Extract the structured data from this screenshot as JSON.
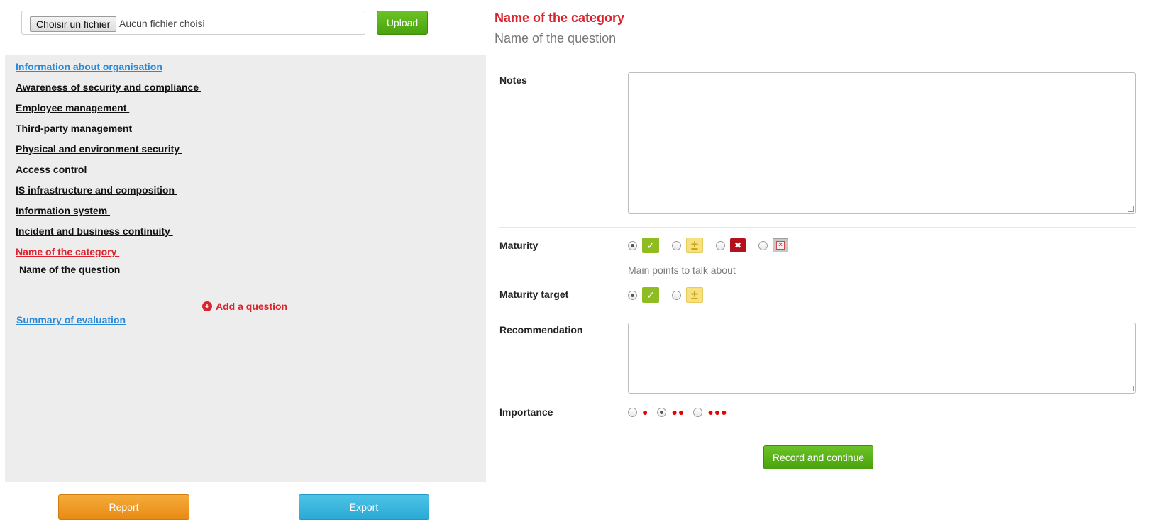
{
  "upload": {
    "choose_label": "Choisir un fichier",
    "file_status": "Aucun fichier choisi",
    "upload_label": "Upload"
  },
  "nav": {
    "items": [
      {
        "label": "Information about organisation",
        "style": "blue"
      },
      {
        "label": "Awareness of security and compliance ",
        "style": "normal"
      },
      {
        "label": "Employee management ",
        "style": "normal"
      },
      {
        "label": "Third-party management ",
        "style": "normal"
      },
      {
        "label": "Physical and environment security ",
        "style": "normal"
      },
      {
        "label": "Access control ",
        "style": "normal"
      },
      {
        "label": "IS infrastructure and composition ",
        "style": "normal"
      },
      {
        "label": "Information system ",
        "style": "normal"
      },
      {
        "label": "Incident and business continuity ",
        "style": "normal"
      },
      {
        "label": "Name of the category ",
        "style": "red"
      }
    ],
    "active_question": "Name of the question",
    "add_question": "Add a question",
    "summary": "Summary of evaluation"
  },
  "actions": {
    "report": "Report",
    "export": "Export",
    "record": "Record and continue"
  },
  "header": {
    "category": "Name of the category",
    "question": "Name of the question"
  },
  "form": {
    "notes_label": "Notes",
    "notes_value": "",
    "maturity_label": "Maturity",
    "maturity_hint": "Main points to talk about",
    "maturity_options": [
      "ok-icon",
      "partial-icon",
      "ko-icon",
      "not-applicable-icon"
    ],
    "maturity_selected": 0,
    "maturity_target_label": "Maturity target",
    "maturity_target_selected": 0,
    "recommendation_label": "Recommendation",
    "recommendation_value": "",
    "importance_label": "Importance",
    "importance_levels": [
      "●",
      "●●",
      "●●●"
    ],
    "importance_selected": 1
  },
  "colors": {
    "accent_red": "#d9232e",
    "link_blue": "#2a8ad8",
    "green": "#5cb31a",
    "orange": "#ee9a24",
    "cyan": "#3ab7e0"
  }
}
